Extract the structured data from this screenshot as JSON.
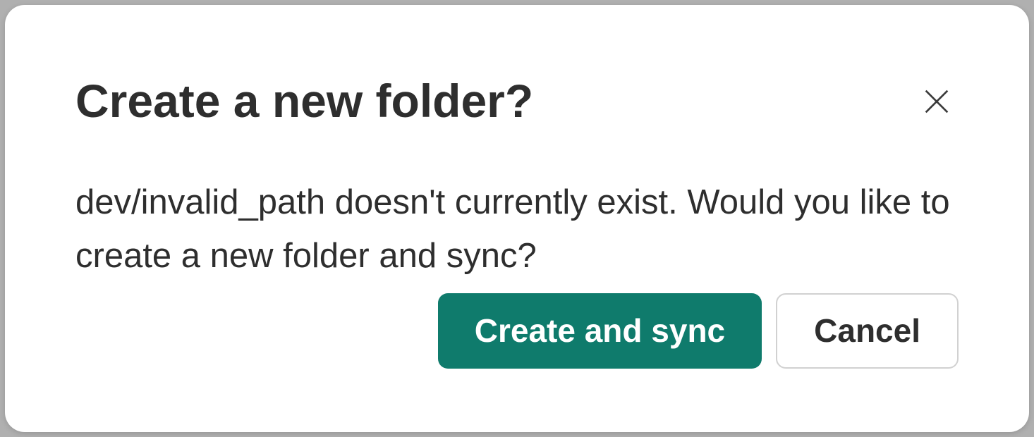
{
  "dialog": {
    "title": "Create a new folder?",
    "body": "dev/invalid_path doesn't currently exist. Would you like to create a new folder and sync?",
    "primary_label": "Create and sync",
    "secondary_label": "Cancel"
  }
}
